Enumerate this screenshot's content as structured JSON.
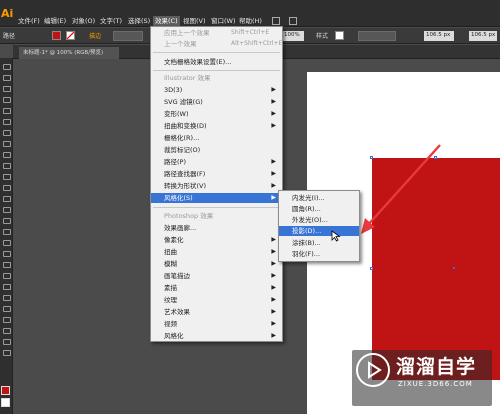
{
  "app": {
    "logo": "Ai"
  },
  "menubar": {
    "items": [
      "文件(F)",
      "编辑(E)",
      "对象(O)",
      "文字(T)",
      "选择(S)",
      "效果(C)",
      "视图(V)",
      "窗口(W)",
      "帮助(H)"
    ],
    "active": "效果(C)"
  },
  "control_bar": {
    "selection_label": "路径",
    "stroke_label": "描边",
    "opacity_value": "100%",
    "style_label": "样式",
    "width_value": "106.5 px",
    "height_value": "106.5 px"
  },
  "document": {
    "tab_label": "未标题-1* @ 100% (RGB/预览)"
  },
  "effect_menu": {
    "apply_last": {
      "label": "应用上一个效果",
      "shortcut": "Shift+Ctrl+E"
    },
    "last_effect": {
      "label": "上一个效果",
      "shortcut": "Alt+Shift+Ctrl+E"
    },
    "raster_settings": "文档栅格效果设置(E)...",
    "illustrator_header": "Illustrator 效果",
    "illustrator_items": [
      "3D(3)",
      "SVG 滤镜(G)",
      "变形(W)",
      "扭曲和变换(D)",
      "栅格化(R)...",
      "裁剪标记(O)",
      "路径(P)",
      "路径查找器(F)",
      "转换为形状(V)",
      "风格化(S)"
    ],
    "photoshop_header": "Photoshop 效果",
    "photoshop_items": [
      "效果画廊...",
      "像素化",
      "扭曲",
      "模糊",
      "画笔描边",
      "素描",
      "纹理",
      "艺术效果",
      "视频",
      "风格化"
    ],
    "highlighted": "风格化(S)"
  },
  "stylize_submenu": {
    "items": [
      "内发光(I)...",
      "圆角(R)...",
      "外发光(O)...",
      "投影(D)...",
      "涂抹(B)...",
      "羽化(F)..."
    ],
    "highlighted": "投影(D)..."
  },
  "watermark": {
    "brand": "溜溜自学",
    "url": "ZIXUE.3D66.COM"
  },
  "colors": {
    "shape_fill": "#c01313",
    "highlight": "#3873d6",
    "annotation_arrow": "#e8393d"
  }
}
